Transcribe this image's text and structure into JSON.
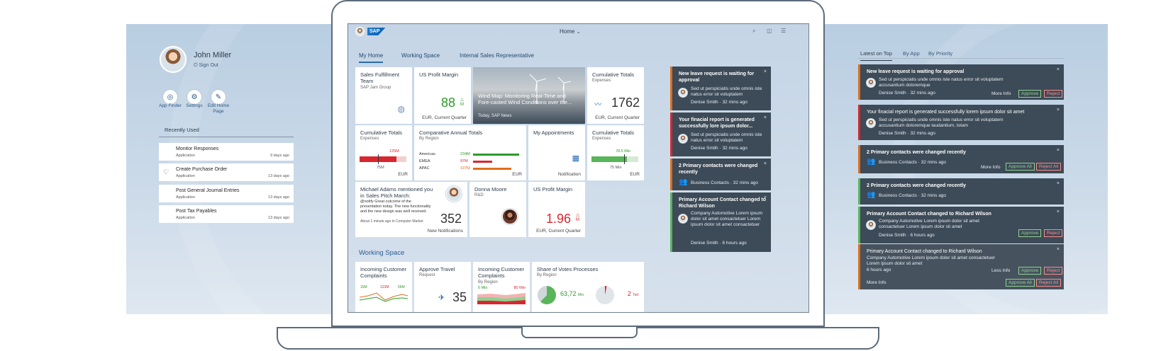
{
  "colors": {
    "accent": "#2a6bb0",
    "positive": "#2b9b2b",
    "negative": "#d9262e",
    "notif_bg": "#3d4a57",
    "notif_border_orange": "#e06e1a",
    "notif_border_red": "#d9262e",
    "notif_border_green": "#58b55a"
  },
  "left_panel": {
    "user_name": "John Miller",
    "sign_out": "Sign Out",
    "actions": [
      {
        "label": "App Finder",
        "icon": "binoculars-icon"
      },
      {
        "label": "Settings",
        "icon": "gear-icon"
      },
      {
        "label": "Edit Home Page",
        "icon": "pencil-icon"
      }
    ],
    "recent_header": "Recently Used",
    "recent_items": [
      {
        "title": "Monitor Responses",
        "type": "Application",
        "date": "9 days ago"
      },
      {
        "title": "Create Purchase Order",
        "type": "Application",
        "date": "13 days ago"
      },
      {
        "title": "Post General Journal Entries",
        "type": "Application",
        "date": "13 days ago"
      },
      {
        "title": "Post Tax Payables",
        "type": "Application",
        "date": "13 days ago"
      }
    ]
  },
  "shell": {
    "logo": "SAP",
    "title": "Home"
  },
  "tabs": [
    "My Home",
    "Working Space",
    "Internal Sales Representative"
  ],
  "tiles": {
    "sales_fulfillment": {
      "title": "Sales Fulfillment Team",
      "subtitle": "SAP Jam Group"
    },
    "profit_margin_1": {
      "title": "US Profit Margin",
      "value": "88",
      "unit": "M",
      "footer": "EUR, Current Quarter"
    },
    "wind_map": {
      "title": "Wind Map: Monitoring Real-Time and Fore-casted Wind Conditions over the...",
      "source": "Today, SAP News"
    },
    "cumulative_1": {
      "title": "Cumulative Totals",
      "subtitle": "Expenses",
      "value": "1762",
      "footer": "EUR, Current Quarter"
    },
    "cumulative_2": {
      "title": "Cumulative Totals",
      "subtitle": "Expenses",
      "target_label": "125M",
      "actual_label": "75M",
      "footer": "EUR"
    },
    "comparative": {
      "title": "Comparative Annual Totals",
      "subtitle": "By Region",
      "rows": [
        {
          "label": "Americas",
          "value": "234M",
          "color": "#2b9b2b",
          "fill": 0.95
        },
        {
          "label": "EMEA",
          "value": "97M",
          "color": "#d9262e",
          "fill": 0.4
        },
        {
          "label": "APAC",
          "value": "197M",
          "color": "#e06e1a",
          "fill": 0.8
        }
      ],
      "footer": "EUR"
    },
    "appointments": {
      "title": "My Appointments",
      "footer": "Notification"
    },
    "cumulative_3": {
      "title": "Cumulative Totals",
      "subtitle": "Expenses",
      "target_label": "78.5 Mio",
      "actual_label": "75 Mio",
      "footer": "EUR"
    },
    "mention": {
      "title": "Michael Adams mentioned you in Sales Pitch March:",
      "body": "@notify Great outcome of the presentation today. The new functionality and the new design was well received.",
      "meta": "About 1 minute ago in Computer Market",
      "value": "352",
      "footer": "New Notifications"
    },
    "donna": {
      "name": "Donna Moore",
      "dept": "R&D"
    },
    "profit_margin_2": {
      "title": "US Profit Margin",
      "value": "1.96",
      "unit": "M",
      "footer": "EUR, Current Quarter"
    }
  },
  "working_space": {
    "title": "Working Space",
    "tiles": [
      {
        "title": "Incoming Customer Complaints",
        "labels": [
          "16M",
          "123M",
          "56M"
        ]
      },
      {
        "title": "Approve Travel",
        "subtitle": "Request",
        "value": "35"
      },
      {
        "title": "Incoming Customer Complaints",
        "subtitle": "By Region",
        "labels": [
          "0 Mio",
          "80 Mio"
        ]
      },
      {
        "title": "Share of Votes Processes",
        "subtitle": "By Region",
        "value1": "63,72",
        "unit1": "Mio",
        "value2": "2",
        "unit2": "Tsd"
      }
    ]
  },
  "notif_center": [
    {
      "title": "New leave request is waiting for approval",
      "body": "Sed ut perspiciatis unde omnis iste natus error sit voluptatem",
      "person": "Denise Smith",
      "time": "32 mins ago"
    },
    {
      "title": "Your finacial report is generated successfully lore ipsum dolor...",
      "body": "Sed ut perspiciatis unde omnis iste natus error sit voluptatem",
      "person": "Denise Smith",
      "time": "32 mins ago"
    },
    {
      "title": "2 Primary contacts were changed recently",
      "person": "Business Contacts",
      "time": "32 mins ago"
    },
    {
      "title": "Primary Account Contact changed to Richard Wilson",
      "body": "Company Automotive Lorem ipsum dolor sit amet consactetuer Lorem ipsum dolor sit amet consactetuer",
      "person": "Denise Smith",
      "time": "6 hours ago"
    }
  ],
  "right_panel": {
    "tabs": [
      "Latest on Top",
      "By App",
      "By Priority"
    ],
    "items": [
      {
        "title": "New leave request is waiting for approval",
        "body": "Sed ut perspiciatis unde omnis iste natus error sit voluptatem accusantium doloremque",
        "person": "Denise Smith",
        "time": "32 mins ago",
        "more": "More Info",
        "approve": "Approve",
        "reject": "Reject"
      },
      {
        "title": "Your finacial report is generated successfully lorem ipsum dolor sit amet",
        "body": "Sed ut perspiciatis unde omnis iste natus error sit voluptatem accusantium doloremque laudantium, totam",
        "person": "Denise Smith",
        "time": "32 mins ago"
      },
      {
        "title": "2 Primary contacts were changed recently",
        "person": "Business Contacts",
        "time": "32 mins ago",
        "more": "More Info",
        "approve": "Approve All",
        "reject": "Reject All"
      },
      {
        "title": "2 Primary contacts were changed recently",
        "person": "Business Contacts",
        "time": "32 mins ago"
      },
      {
        "title": "Primary Account Contact changed to Richard Wilson",
        "body": "Company Automotive Lorem ipsum dolor sit amet consactetuer Lorem ipsum dolor sit amet",
        "person": "Denise Smith",
        "time": "6 hours ago",
        "approve": "Approve",
        "reject": "Reject"
      },
      {
        "title": "Primary Account Contact changed to Richard Wilson",
        "body": "Company Automotive Lorem ipsum dolor sit amet consactetuer Lorem ipsum dolor sit amet",
        "time": "6 hours ago",
        "more": "Less Info",
        "approve": "Approve",
        "reject": "Reject"
      }
    ],
    "footer": {
      "more": "More Info",
      "approve": "Approve All",
      "reject": "Reject All"
    }
  }
}
